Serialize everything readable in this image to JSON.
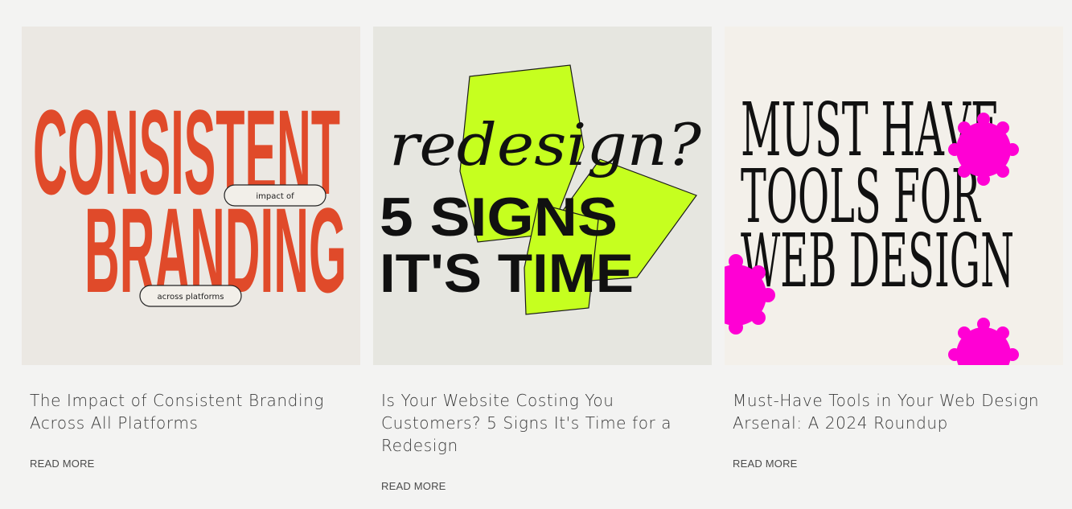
{
  "posts": [
    {
      "image": {
        "headline_line1": "CONSISTENT",
        "headline_line2": "BRANDING",
        "pill_top": "impact of",
        "pill_bottom": "across platforms",
        "background": "#ebe8e3",
        "accent": "#e04a2a"
      },
      "title": "The Impact of Consistent Branding Across All Platforms",
      "read_more": "READ MORE"
    },
    {
      "image": {
        "script_word": "redesign?",
        "line1": "5 SIGNS",
        "line2": "IT'S TIME",
        "background": "#e6e6e0",
        "accent": "#c6ff1f"
      },
      "title": "Is Your Website Costing You Customers? 5 Signs It's Time for a Redesign",
      "read_more": "READ MORE"
    },
    {
      "image": {
        "line1": "MUST HAVE",
        "line2": "TOOLS FOR",
        "line3": "WEB DESIGN",
        "background": "#f3f0ea",
        "accent": "#ff00d4"
      },
      "title": "Must-Have Tools in Your Web Design Arsenal: A 2024 Roundup",
      "read_more": "READ MORE"
    }
  ]
}
